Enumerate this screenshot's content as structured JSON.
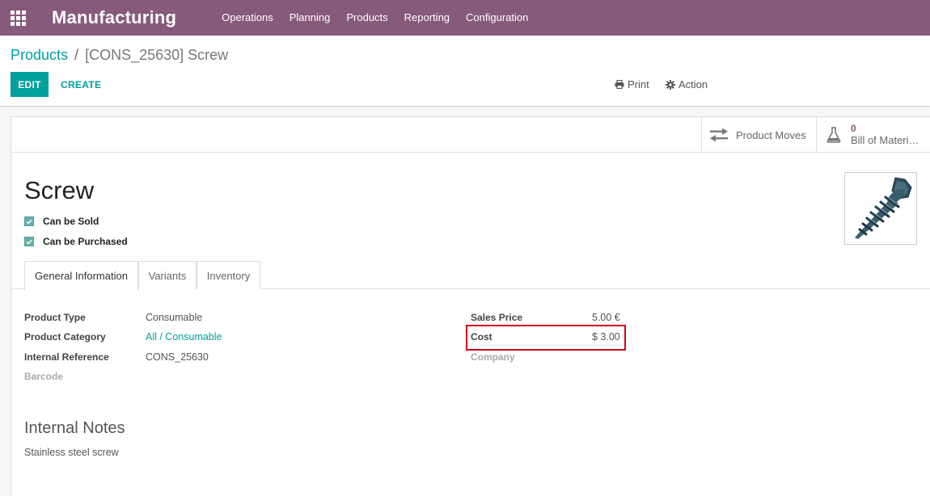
{
  "navbar": {
    "brand": "Manufacturing",
    "menu": [
      "Operations",
      "Planning",
      "Products",
      "Reporting",
      "Configuration"
    ]
  },
  "breadcrumb": {
    "parent": "Products",
    "separator": "/",
    "current": "[CONS_25630] Screw"
  },
  "actions": {
    "edit": "EDIT",
    "create": "CREATE",
    "print": "Print",
    "action": "Action"
  },
  "smart_buttons": {
    "moves": {
      "label": "Product Moves",
      "icon": "exchange-icon"
    },
    "bom": {
      "count": "0",
      "label": "Bill of Materi…",
      "icon": "flask-icon"
    }
  },
  "product": {
    "name": "Screw",
    "can_be_sold": {
      "label": "Can be Sold",
      "checked": true
    },
    "can_be_purchased": {
      "label": "Can be Purchased",
      "checked": true
    },
    "image_icon": "screw-image"
  },
  "tabs": [
    "General Information",
    "Variants",
    "Inventory"
  ],
  "general": {
    "left": [
      {
        "label": "Product Type",
        "value": "Consumable"
      },
      {
        "label": "Product Category",
        "value": "All / Consumable"
      },
      {
        "label": "Internal Reference",
        "value": "CONS_25630"
      },
      {
        "label": "Barcode",
        "value": ""
      }
    ],
    "right": [
      {
        "label": "Sales Price",
        "value": "5.00 €"
      },
      {
        "label": "Cost",
        "value": "$ 3.00"
      },
      {
        "label": "Company",
        "value": ""
      }
    ]
  },
  "notes": {
    "title": "Internal Notes",
    "text": "Stainless steel screw"
  },
  "colors": {
    "brand": "#875a7b",
    "accent": "#00a09d",
    "highlight": "#d0021b"
  }
}
